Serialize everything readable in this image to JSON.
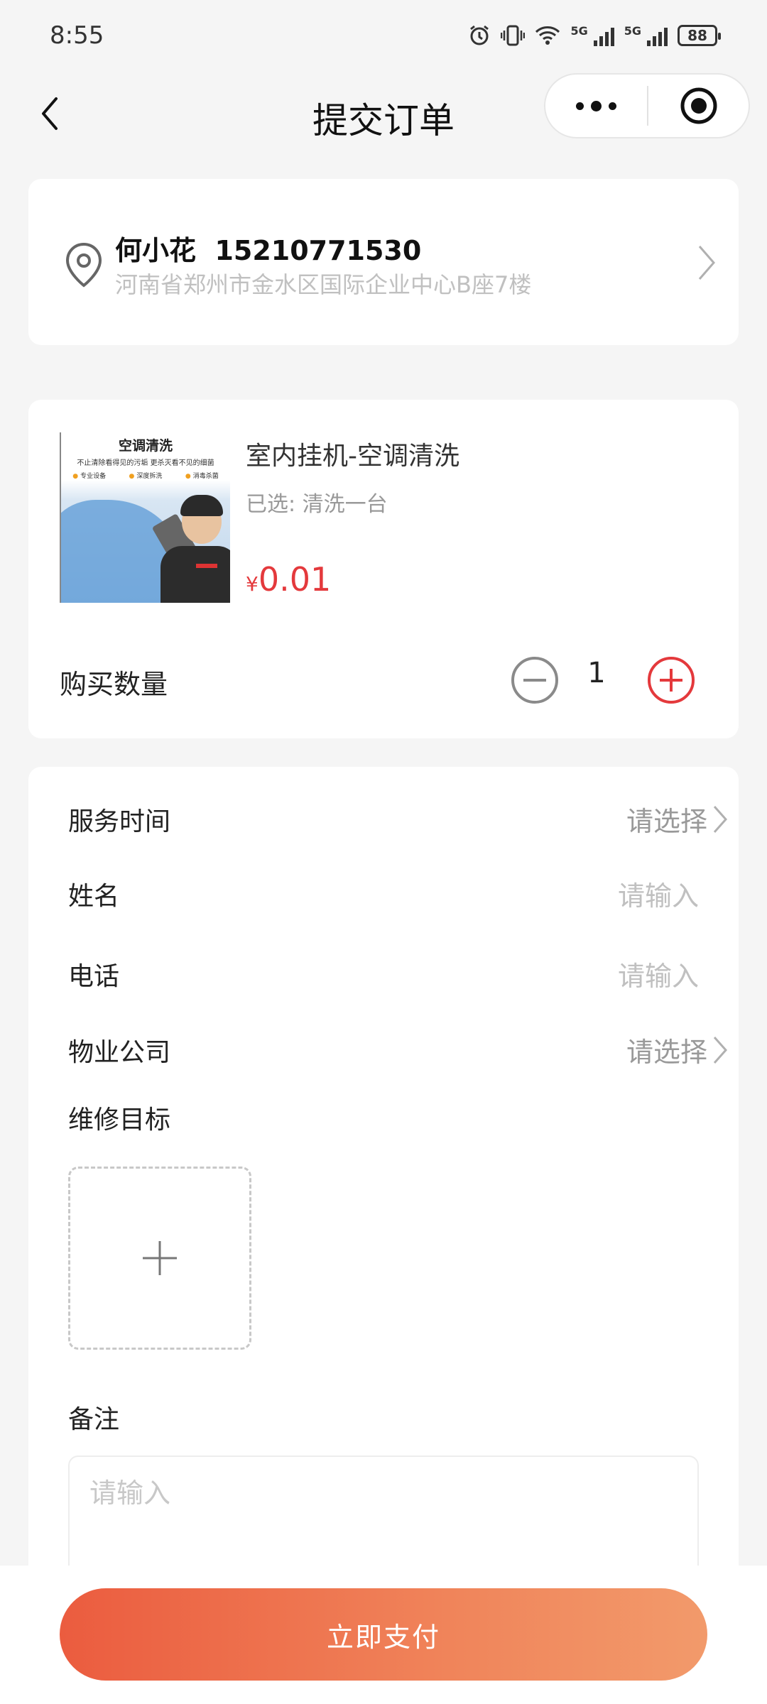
{
  "status_bar": {
    "time": "8:55",
    "signal_1_label": "5G",
    "signal_2_label": "5G",
    "battery": "88"
  },
  "nav": {
    "title": "提交订单"
  },
  "address": {
    "name_phone": "何小花  15210771530",
    "detail": "河南省郑州市金水区国际企业中心B座7楼"
  },
  "product": {
    "image_title": "空调清洗",
    "image_subtitle": "不止清除看得见的污垢 更杀灭看不见的细菌",
    "image_tags": [
      "专业设备",
      "深度拆洗",
      "消毒杀菌"
    ],
    "name": "室内挂机-空调清洗",
    "selected": "已选: 清洗一台",
    "price_symbol": "¥",
    "price": "0.01"
  },
  "quantity": {
    "label": "购买数量",
    "value": "1"
  },
  "form": {
    "service_time": {
      "label": "服务时间",
      "value": "请选择"
    },
    "name": {
      "label": "姓名",
      "placeholder": "请输入"
    },
    "phone": {
      "label": "电话",
      "placeholder": "请输入"
    },
    "property": {
      "label": "物业公司",
      "value": "请选择"
    },
    "repair_target": {
      "label": "维修目标"
    },
    "remark": {
      "label": "备注",
      "placeholder": "请输入"
    }
  },
  "pay_button": "立即支付",
  "colors": {
    "accent": "#e4393c",
    "button_start": "#eb5c3f",
    "button_end": "#f29a6b"
  },
  "icons": [
    "back-icon",
    "more-icon",
    "close-target-icon",
    "location-pin-icon",
    "chevron-right-icon",
    "minus-circle-icon",
    "plus-circle-icon",
    "plus-icon"
  ]
}
